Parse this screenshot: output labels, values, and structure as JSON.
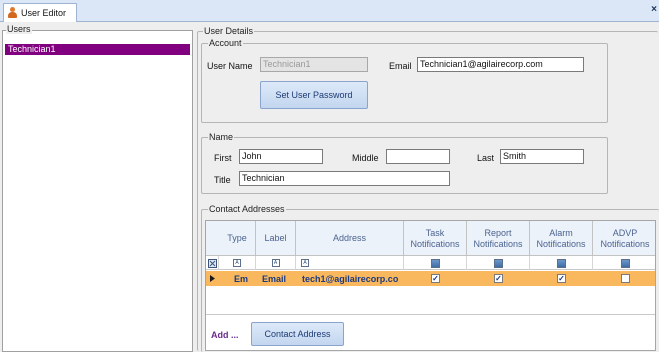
{
  "window": {
    "tab_title": "User Editor",
    "tab_icon": "user-icon",
    "close_glyph": "×"
  },
  "users_panel": {
    "caption": "Users",
    "items": [
      "Technician1"
    ],
    "selected_index": 0,
    "selected_color": "#800080"
  },
  "user_details": {
    "caption": "User Details",
    "account": {
      "caption": "Account",
      "username_label": "User Name",
      "username_value": "Technician1",
      "email_label": "Email",
      "email_value": "Technician1@agilairecorp.com",
      "set_password_button": "Set User Password"
    },
    "name": {
      "caption": "Name",
      "first_label": "First",
      "first_value": "John",
      "middle_label": "Middle",
      "middle_value": "",
      "last_label": "Last",
      "last_value": "Smith",
      "title_label": "Title",
      "title_value": "Technician"
    },
    "contact": {
      "caption": "Contact Addresses",
      "columns": [
        "Type",
        "Label",
        "Address",
        "Task Notifications",
        "Report Notifications",
        "Alarm Notifications",
        "ADVP Notifications"
      ],
      "rows": [
        {
          "type": "Em",
          "label": "Email",
          "address": "tech1@agilairecorp.co",
          "task": true,
          "report": true,
          "alarm": true,
          "advp": false
        }
      ],
      "row_highlight_color": "#f9b85d",
      "add_label": "Add ...",
      "add_button": "Contact Address"
    }
  }
}
